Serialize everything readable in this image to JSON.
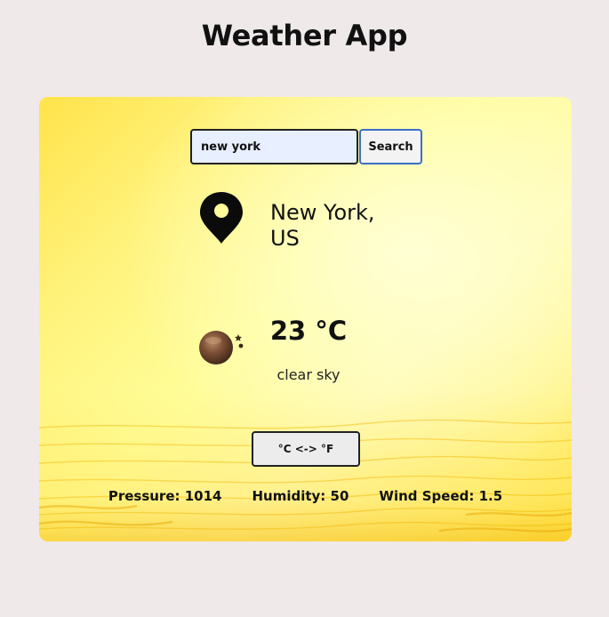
{
  "app": {
    "title": "Weather App"
  },
  "search": {
    "value": "new york",
    "button_label": "Search"
  },
  "location": {
    "city": "New York,",
    "country": "US",
    "icon": "map-pin-icon"
  },
  "weather": {
    "icon": "weather-condition-icon",
    "temperature": "23 °C",
    "description": "clear sky"
  },
  "unit_toggle": {
    "label": "°C <-> °F"
  },
  "stats": {
    "pressure": "Pressure: 1014",
    "humidity": "Humidity: 50",
    "wind_speed": "Wind Speed: 1.5"
  },
  "colors": {
    "page_background": "#efe9e9",
    "card_yellow": "#fff27a",
    "search_input_background": "#e8efff",
    "search_button_border": "#3b6fc4"
  }
}
